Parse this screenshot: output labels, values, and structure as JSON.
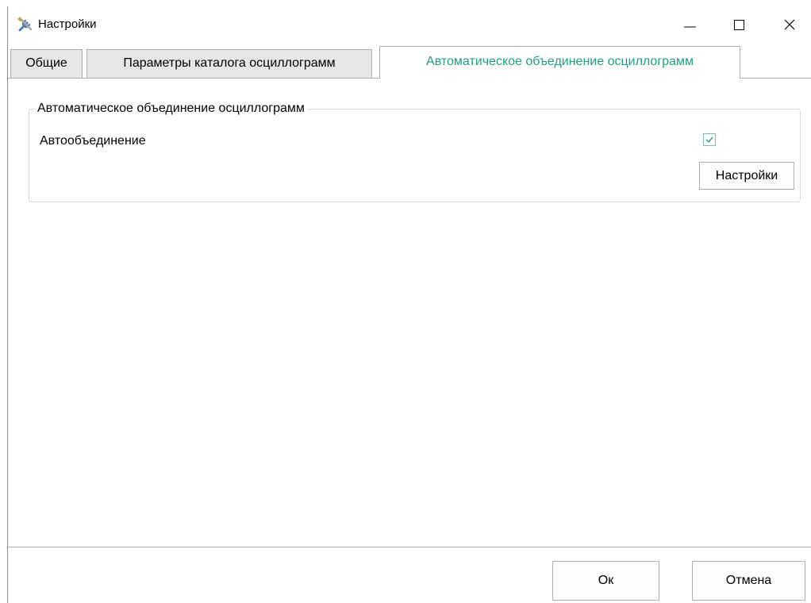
{
  "window": {
    "title": "Настройки"
  },
  "tabs": [
    {
      "label": "Общие",
      "active": false
    },
    {
      "label": "Параметры каталога осциллограмм",
      "active": false
    },
    {
      "label": "Автоматическое объединение осциллограмм",
      "active": true
    }
  ],
  "group": {
    "title": "Автоматическое объединение осциллограмм",
    "autojoin_label": "Автообъединение",
    "autojoin_checked": true,
    "settings_button": "Настройки"
  },
  "footer": {
    "ok": "Ок",
    "cancel": "Отмена"
  },
  "colors": {
    "accent": "#1e9e85"
  }
}
